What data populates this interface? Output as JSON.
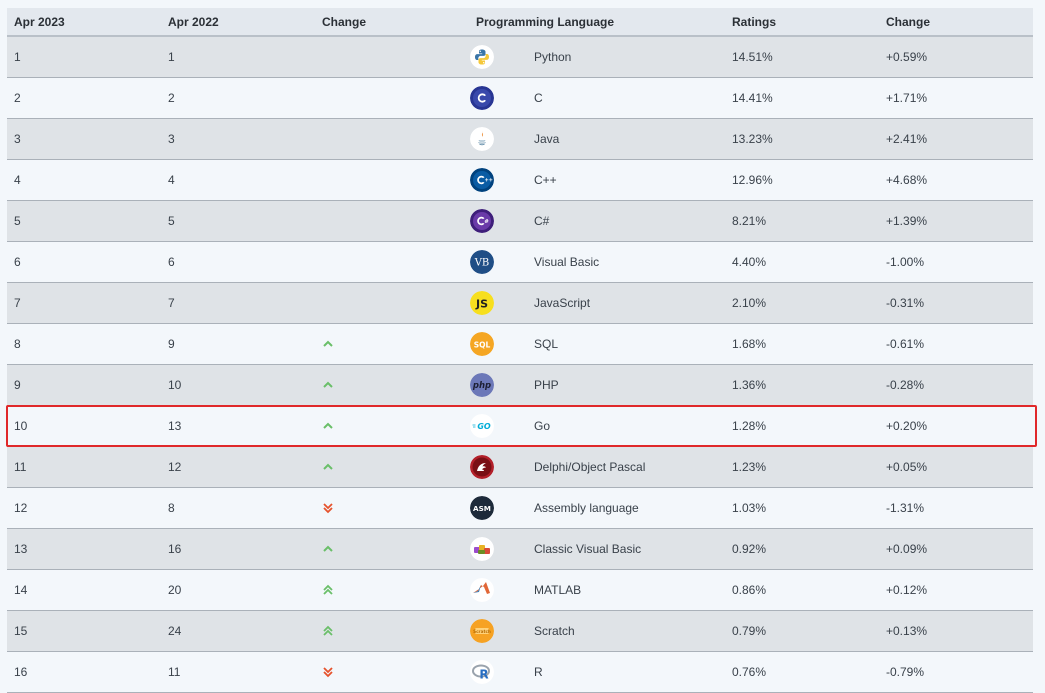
{
  "headers": {
    "rank_current": "Apr 2023",
    "rank_previous": "Apr 2022",
    "change": "Change",
    "language": "Programming Language",
    "ratings": "Ratings",
    "ratings_change": "Change"
  },
  "colors": {
    "up_arrow": "#6abf69",
    "down_arrow": "#e6522c",
    "highlight_border": "#e0282a"
  },
  "rows": [
    {
      "cur": "1",
      "prev": "1",
      "trend": "none",
      "icon": "python-logo-icon",
      "lang": "Python",
      "rating": "14.51%",
      "delta": "+0.59%"
    },
    {
      "cur": "2",
      "prev": "2",
      "trend": "none",
      "icon": "c-logo-icon",
      "lang": "C",
      "rating": "14.41%",
      "delta": "+1.71%"
    },
    {
      "cur": "3",
      "prev": "3",
      "trend": "none",
      "icon": "java-logo-icon",
      "lang": "Java",
      "rating": "13.23%",
      "delta": "+2.41%"
    },
    {
      "cur": "4",
      "prev": "4",
      "trend": "none",
      "icon": "cpp-logo-icon",
      "lang": "C++",
      "rating": "12.96%",
      "delta": "+4.68%"
    },
    {
      "cur": "5",
      "prev": "5",
      "trend": "none",
      "icon": "csharp-logo-icon",
      "lang": "C#",
      "rating": "8.21%",
      "delta": "+1.39%"
    },
    {
      "cur": "6",
      "prev": "6",
      "trend": "none",
      "icon": "visual-basic-logo-icon",
      "lang": "Visual Basic",
      "rating": "4.40%",
      "delta": "-1.00%"
    },
    {
      "cur": "7",
      "prev": "7",
      "trend": "none",
      "icon": "javascript-logo-icon",
      "lang": "JavaScript",
      "rating": "2.10%",
      "delta": "-0.31%"
    },
    {
      "cur": "8",
      "prev": "9",
      "trend": "up",
      "icon": "sql-logo-icon",
      "lang": "SQL",
      "rating": "1.68%",
      "delta": "-0.61%"
    },
    {
      "cur": "9",
      "prev": "10",
      "trend": "up",
      "icon": "php-logo-icon",
      "lang": "PHP",
      "rating": "1.36%",
      "delta": "-0.28%"
    },
    {
      "cur": "10",
      "prev": "13",
      "trend": "up",
      "icon": "go-logo-icon",
      "lang": "Go",
      "rating": "1.28%",
      "delta": "+0.20%",
      "highlighted": true
    },
    {
      "cur": "11",
      "prev": "12",
      "trend": "up",
      "icon": "delphi-logo-icon",
      "lang": "Delphi/Object Pascal",
      "rating": "1.23%",
      "delta": "+0.05%"
    },
    {
      "cur": "12",
      "prev": "8",
      "trend": "down-double",
      "icon": "assembly-logo-icon",
      "lang": "Assembly language",
      "rating": "1.03%",
      "delta": "-1.31%"
    },
    {
      "cur": "13",
      "prev": "16",
      "trend": "up",
      "icon": "classic-visual-basic-logo-icon",
      "lang": "Classic Visual Basic",
      "rating": "0.92%",
      "delta": "+0.09%"
    },
    {
      "cur": "14",
      "prev": "20",
      "trend": "up-double",
      "icon": "matlab-logo-icon",
      "lang": "MATLAB",
      "rating": "0.86%",
      "delta": "+0.12%"
    },
    {
      "cur": "15",
      "prev": "24",
      "trend": "up-double",
      "icon": "scratch-logo-icon",
      "lang": "Scratch",
      "rating": "0.79%",
      "delta": "+0.13%"
    },
    {
      "cur": "16",
      "prev": "11",
      "trend": "down-double",
      "icon": "r-logo-icon",
      "lang": "R",
      "rating": "0.76%",
      "delta": "-0.79%"
    }
  ]
}
